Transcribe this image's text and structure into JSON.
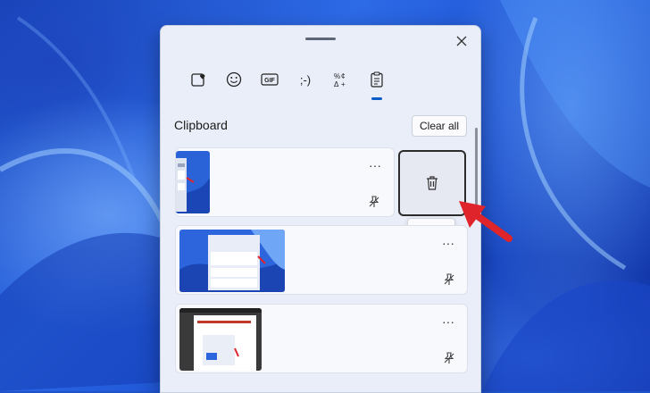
{
  "panel": {
    "tabs": [
      {
        "icon": "sticker-heart-icon",
        "active": false
      },
      {
        "icon": "emoji-smile-icon",
        "active": false
      },
      {
        "icon": "gif-icon",
        "active": false,
        "glyph": "GIF"
      },
      {
        "icon": "kaomoji-icon",
        "active": false,
        "glyph": ";-)"
      },
      {
        "icon": "symbols-icon",
        "active": false
      },
      {
        "icon": "clipboard-icon",
        "active": true
      }
    ],
    "section_title": "Clipboard",
    "clear_all_label": "Clear all",
    "items": [
      {
        "more_label": "···",
        "thumb": "screenshot-wallpaper-narrow"
      },
      {
        "more_label": "···",
        "thumb": "screenshot-clipboard-panel"
      },
      {
        "more_label": "···",
        "thumb": "screenshot-document"
      }
    ],
    "delete_tooltip": "Delete",
    "close_icon": "close-icon"
  },
  "colors": {
    "accent": "#0b5cc9",
    "annotation_arrow": "#e0242b"
  }
}
